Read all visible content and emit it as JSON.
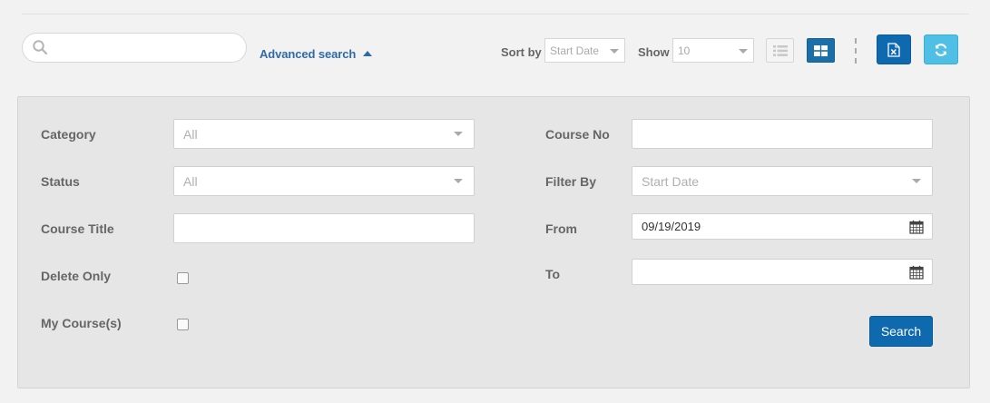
{
  "toolbar": {
    "search_value": "",
    "search_placeholder": "",
    "advanced_search_label": "Advanced search",
    "sort_by_label": "Sort by",
    "sort_by_value": "Start Date",
    "show_label": "Show",
    "show_value": "10"
  },
  "filters": {
    "category_label": "Category",
    "category_value": "All",
    "status_label": "Status",
    "status_value": "All",
    "course_title_label": "Course Title",
    "course_title_value": "",
    "delete_only_label": "Delete Only",
    "my_courses_label": "My Course(s)",
    "course_no_label": "Course No",
    "course_no_value": "",
    "filter_by_label": "Filter By",
    "filter_by_value": "Start Date",
    "from_label": "From",
    "from_value": "09/19/2019",
    "to_label": "To",
    "to_value": "",
    "search_button_label": "Search"
  },
  "icons": {
    "search": "search-icon",
    "advanced_toggle": "caret-up-icon",
    "list_view": "list-view-icon",
    "grid_view": "grid-view-icon",
    "excel_export": "excel-icon",
    "refresh": "refresh-icon",
    "calendar": "calendar-icon"
  },
  "colors": {
    "primary": "#0e69ae",
    "accent_refresh": "#4fbfe5",
    "link": "#2f6aa8",
    "panel_bg": "#e6e6e6",
    "page_bg": "#f2f2f2"
  }
}
